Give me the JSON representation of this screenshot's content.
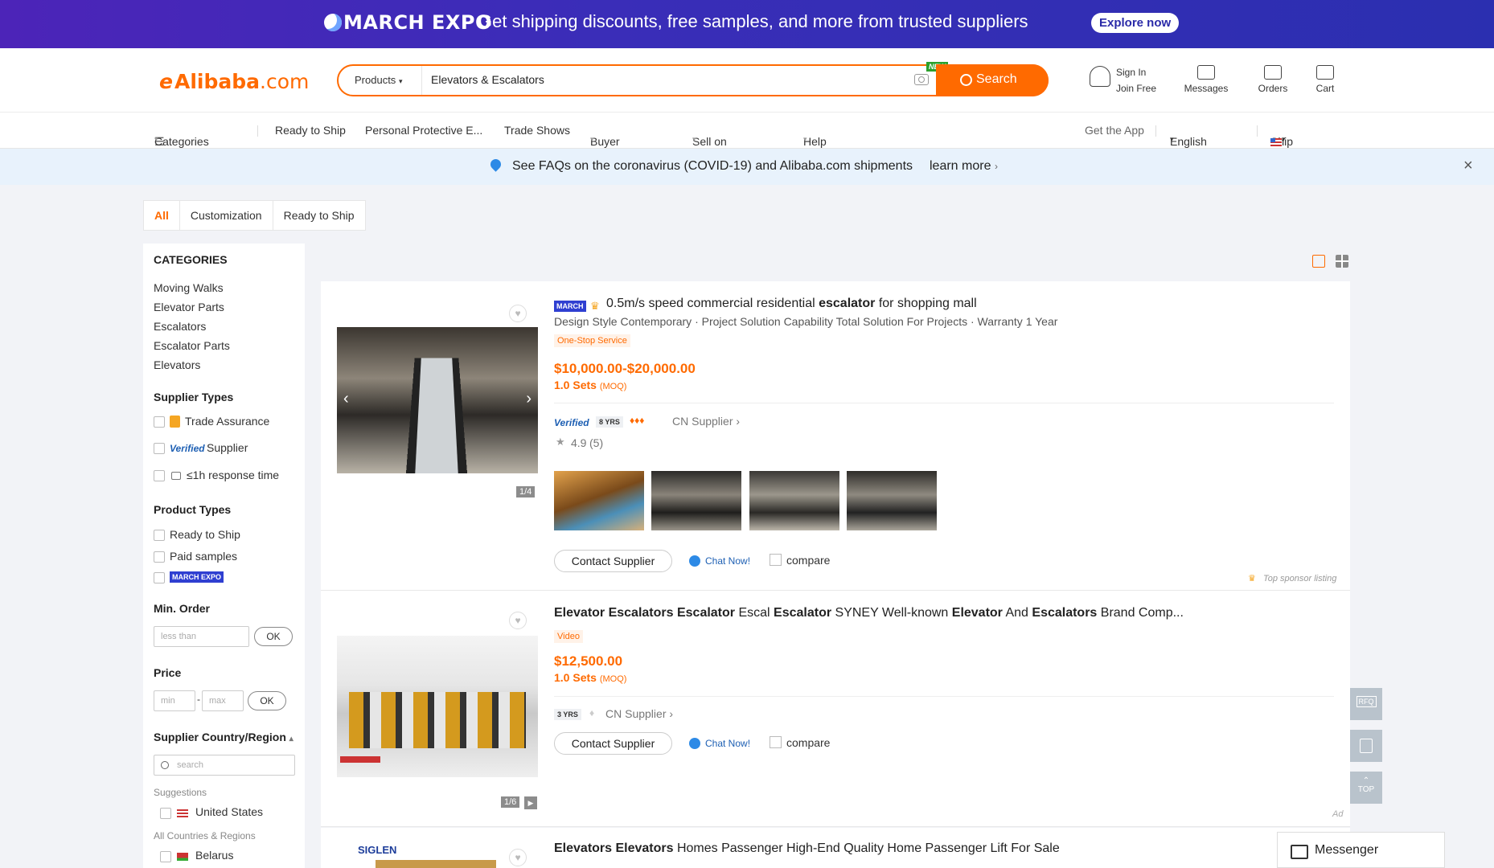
{
  "promo": {
    "logo": "MARCH EXPO",
    "message": "Get shipping discounts, free samples, and more from trusted suppliers",
    "button": "Explore now"
  },
  "header": {
    "logo_main": "Alibaba",
    "logo_suffix": ".com",
    "search": {
      "category": "Products",
      "value": "Elevators & Escalators",
      "new_badge": "NEW",
      "button": "Search"
    },
    "account": {
      "sign_in": "Sign In",
      "join": "Join Free"
    },
    "messages": "Messages",
    "orders": "Orders",
    "cart": "Cart"
  },
  "nav": {
    "categories": "Categories",
    "ready": "Ready to Ship",
    "ppe": "Personal Protective E...",
    "trade_shows": "Trade Shows",
    "buyer_central": "Buyer Central",
    "sell": "Sell on Alibaba",
    "help": "Help",
    "get_app": "Get the App",
    "language": "English - USD",
    "ship_to": "Ship to:"
  },
  "covid": {
    "text": "See FAQs on the coronavirus (COVID-19) and Alibaba.com shipments",
    "link": "learn more"
  },
  "tabs": [
    "All",
    "Customization",
    "Ready to Ship"
  ],
  "sidebar": {
    "categories_title": "CATEGORIES",
    "categories": [
      "Moving Walks",
      "Elevator Parts",
      "Escalators",
      "Escalator Parts",
      "Elevators"
    ],
    "supplier_types_title": "Supplier Types",
    "supplier_types": [
      "Trade Assurance",
      "Supplier",
      "≤1h response time"
    ],
    "verified_label": "Verified",
    "product_types_title": "Product Types",
    "product_types": [
      "Ready to Ship",
      "Paid samples"
    ],
    "march_expo": "MARCH EXPO",
    "min_order_title": "Min. Order",
    "min_order_placeholder": "less than",
    "ok": "OK",
    "price_title": "Price",
    "price_min": "min",
    "price_max": "max",
    "price_dash": "-",
    "country_title": "Supplier Country/Region",
    "country_search": "search",
    "suggestions": "Suggestions",
    "suggested_country": "United States",
    "all_regions": "All Countries & Regions",
    "region_first": "Belarus"
  },
  "products": [
    {
      "badge": "MARCH",
      "title_parts": [
        "0.5m/s speed commercial residential ",
        "escalator",
        " for shopping mall"
      ],
      "attrs": "Design Style Contemporary · Project Solution Capability Total Solution For Projects · Warranty 1 Year",
      "tag": "One-Stop Service",
      "price": "$10,000.00-$20,000.00",
      "moq_qty": "1.0 Sets",
      "moq_label": "(MOQ)",
      "verified": "Verified",
      "years": "8 YRS",
      "country": "CN Supplier",
      "rating": "4.9",
      "reviews": "(5)",
      "img_count": "1/4",
      "contact": "Contact Supplier",
      "chat": "Chat Now!",
      "compare": "compare",
      "footer_note": "Top sponsor listing"
    },
    {
      "title_parts": [
        "Elevator Escalators Escalator",
        " Escal ",
        "Escalator",
        " SYNEY Well-known ",
        "Elevator",
        " And ",
        "Escalators",
        " Brand Comp..."
      ],
      "tag": "Video",
      "price": "$12,500.00",
      "moq_qty": "1.0 Sets",
      "moq_label": "(MOQ)",
      "years": "3 YRS",
      "country": "CN Supplier",
      "img_count": "1/6",
      "contact": "Contact Supplier",
      "chat": "Chat Now!",
      "compare": "compare",
      "footer_note": "Ad"
    },
    {
      "brand_logo": "SIGLEN",
      "title_parts": [
        "Elevators Elevators",
        " Homes Passenger High-End Quality Home Passenger Lift For Sale"
      ]
    }
  ],
  "floating": {
    "rfq": "RFQ",
    "top": "TOP"
  },
  "messenger": "Messenger",
  "colors": {
    "accent": "#ff6a00",
    "promo_bg": "#3a2db8",
    "covid_bg": "#e8f2fc",
    "verified_blue": "#1d5fb3"
  }
}
